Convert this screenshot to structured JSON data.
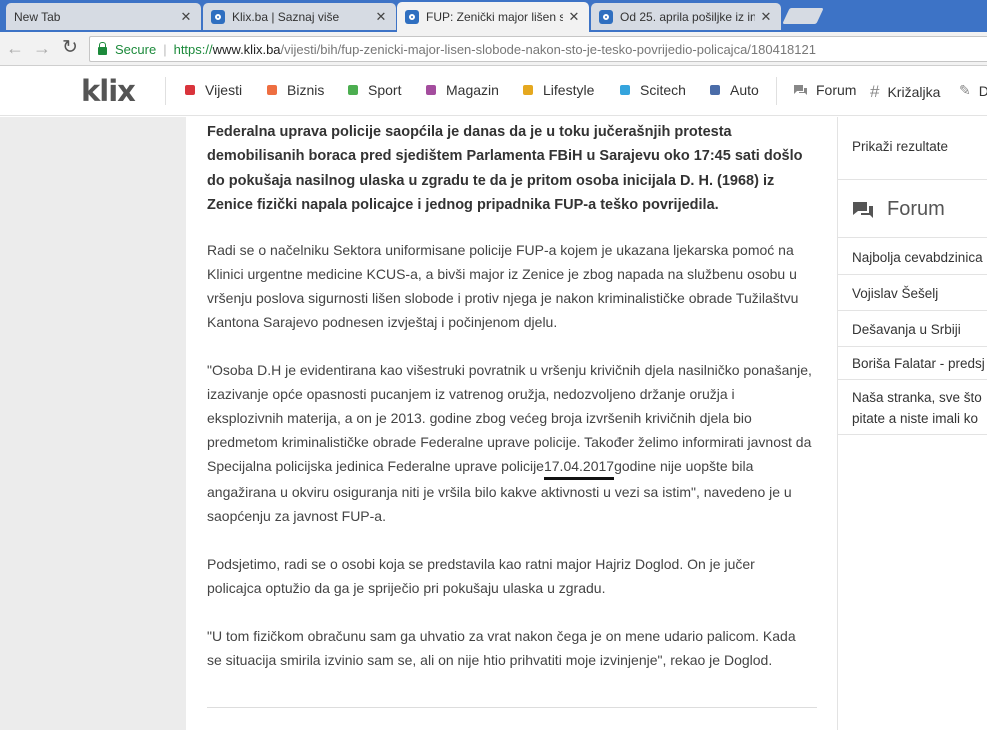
{
  "browser": {
    "tabs": [
      {
        "title": "New Tab",
        "close": "✕",
        "has_favicon": false
      },
      {
        "title": "Klix.ba | Saznaj više",
        "close": "✕",
        "has_favicon": true
      },
      {
        "title": "FUP: Zenički major lišen s",
        "close": "✕",
        "has_favicon": true,
        "active": true
      },
      {
        "title": "Od 25. aprila pošiljke iz in",
        "close": "✕",
        "has_favicon": true
      }
    ],
    "nav": {
      "back": "←",
      "forward": "→",
      "reload": "↻"
    },
    "security_label": "Secure",
    "url": {
      "scheme": "https://",
      "host": "www.klix.ba",
      "path": "/vijesti/bih/fup-zenicki-major-lisen-slobode-nakon-sto-je-tesko-povrijedio-policajca/180418121"
    }
  },
  "site": {
    "logo": "klix",
    "nav": [
      {
        "label": "Vijesti",
        "color": "#d9343c"
      },
      {
        "label": "Biznis",
        "color": "#ee6e41"
      },
      {
        "label": "Sport",
        "color": "#4cae50"
      },
      {
        "label": "Magazin",
        "color": "#a44d9e"
      },
      {
        "label": "Lifestyle",
        "color": "#e5a81f"
      },
      {
        "label": "Scitech",
        "color": "#35a4dd"
      },
      {
        "label": "Auto",
        "color": "#4a6ca8"
      }
    ],
    "tools": [
      {
        "label": "Forum",
        "icon": "chat-icon"
      },
      {
        "label": "Križaljka",
        "icon": "hash-icon"
      },
      {
        "label": "D",
        "icon": "edit-icon"
      }
    ]
  },
  "article": {
    "lead": "Federalna uprava policije saopćila je danas da je u toku jučerašnjih protesta demobilisanih boraca pred sjedištem Parlamenta FBiH u Sarajevu oko 17:45 sati došlo do pokušaja nasilnog ulaska u zgradu te da je pritom osoba inicijala D. H. (1968) iz Zenice fizički napala policajce i jednog pripadnika FUP-a teško povrijedila.",
    "p1": "Radi se o načelniku Sektora uniformisane policije FUP-a kojem je ukazana ljekarska pomoć na Klinici urgentne medicine KCUS-a, a bivši major iz Zenice je zbog napada na službenu osobu u vršenju poslova sigurnosti lišen slobode i protiv njega je nakon kriminalističke obrade Tužilaštvu Kantona Sarajevo podnesen izvještaj i počinjenom djelu.",
    "p2_before": "\"Osoba D.H je evidentirana kao višestruki povratnik u vršenju krivičnih djela nasilničko ponašanje, izazivanje opće opasnosti pucanjem iz vatrenog oružja, nedozvoljeno držanje oružja i eksplozivnih materija, a on je 2013. godine zbog većeg broja izvršenih krivičnih djela bio predmetom kriminalističke obrade Federalne uprave policije. Također želimo informirati javnost da Specijalna policijska jedinica Federalne uprave policije",
    "p2_date": " 17.04.2017 ",
    "p2_after": "godine nije uopšte bila angažirana u okviru osiguranja niti je vršila bilo kakve aktivnosti u vezi sa istim\", navedeno je u saopćenju za javnost FUP-a.",
    "p3": "Podsjetimo, radi se o osobi koja se predstavila kao ratni major Hajriz Doglod. On je jučer policajca optužio da ga je spriječio pri pokušaju ulaska u zgradu.",
    "p4": "\"U tom fizičkom obračunu sam ga uhvatio za vrat nakon čega je on mene udario palicom. Kada se situacija smirila izvinio sam se, ali on nije htio prihvatiti moje izvinjenje\", rekao je Doglod."
  },
  "sidebar": {
    "results_label": "Prikaži rezultate",
    "forum_title": "Forum",
    "forum_links": [
      "Najbolja cevabdzinica",
      "Vojislav Šešelj",
      "Dešavanja u Srbiji",
      "Boriša Falatar - predsj",
      "Naša stranka, sve što",
      "pitate a niste imali ko"
    ]
  }
}
